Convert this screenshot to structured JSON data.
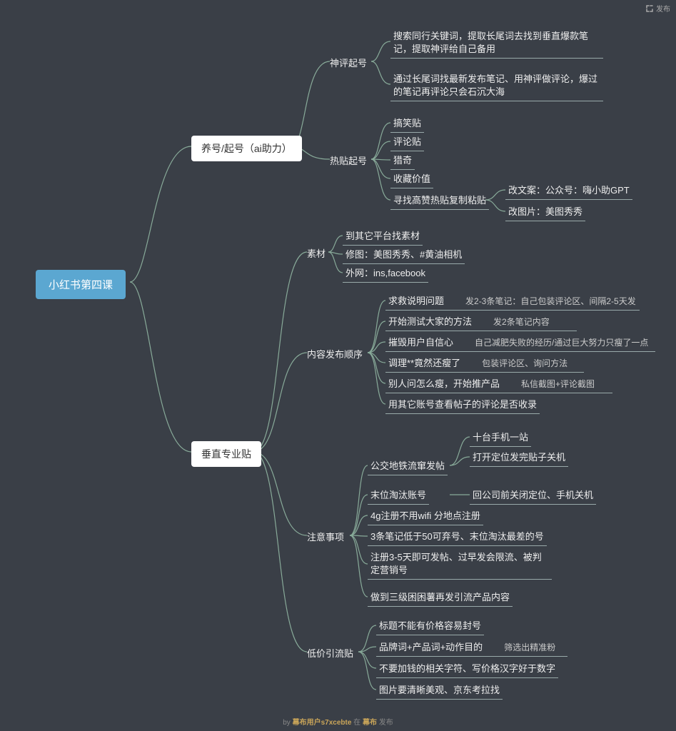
{
  "topbar": {
    "label": "发布"
  },
  "footer": {
    "by": "by ",
    "user": "幕布用户s7xcebte",
    "mid": " 在 ",
    "app": "幕布",
    "end": " 发布"
  },
  "root": "小红书第四课",
  "b1": {
    "label": "养号/起号（ai助力）",
    "sp": {
      "label": "神评起号",
      "l0": "搜索同行关键词，提取长尾词去找到垂直爆款笔记，提取神评给自己备用",
      "l1": "通过长尾词找最新发布笔记、用神评做评论，爆过的笔记再评论只会石沉大海"
    },
    "rt": {
      "label": "热贴起号",
      "l0": "搞笑贴",
      "l1": "评论贴",
      "l2": "猎奇",
      "l3": "收藏价值",
      "l4": "寻找高赞热贴复制粘贴",
      "c0": "改文案：公众号：嗨小助GPT",
      "c1": "改图片：美图秀秀"
    }
  },
  "b2": {
    "label": "垂直专业贴",
    "sc": {
      "label": "素材",
      "l0": "到其它平台找素材",
      "l1": "修图：美图秀秀、#黄油相机",
      "l2": "外网：ins,facebook"
    },
    "seq": {
      "label": "内容发布顺序",
      "l0": "求救说明问题",
      "n0": "发2-3条笔记：自己包装评论区、间隔2-5天发",
      "l1": "开始测试大家的方法",
      "n1": "发2条笔记内容",
      "l2": "摧毁用户自信心",
      "n2": "自己减肥失败的经历/通过巨大努力只瘦了一点",
      "l3": "调理**竟然还瘦了",
      "n3": "包装评论区、询问方法",
      "l4": "别人问怎么瘦，开始推产品",
      "n4": "私信截图+评论截图",
      "l5": "用其它账号查看帖子的评论是否收录"
    },
    "zy": {
      "label": "注意事项",
      "l0": "公交地铁流窜发帖",
      "n0a": "十台手机一站",
      "n0b": "打开定位发完贴子关机",
      "l1": "末位淘汰账号",
      "n1": "回公司前关闭定位、手机关机",
      "l2": "4g注册不用wifi 分地点注册",
      "l3": "3条笔记低于50可弃号、末位淘汰最差的号",
      "l4": "注册3-5天即可发帖、过早发会限流、被判定营销号",
      "l5": "做到三级困困薯再发引流产品内容"
    },
    "dy": {
      "label": "低价引流贴",
      "l0": "标题不能有价格容易封号",
      "l1": "品牌词+产品词+动作目的",
      "n1": "筛选出精准粉",
      "l2": "不要加钱的相关字符、写价格汉字好于数字",
      "l3": "图片要清晰美观、京东考拉找"
    }
  }
}
